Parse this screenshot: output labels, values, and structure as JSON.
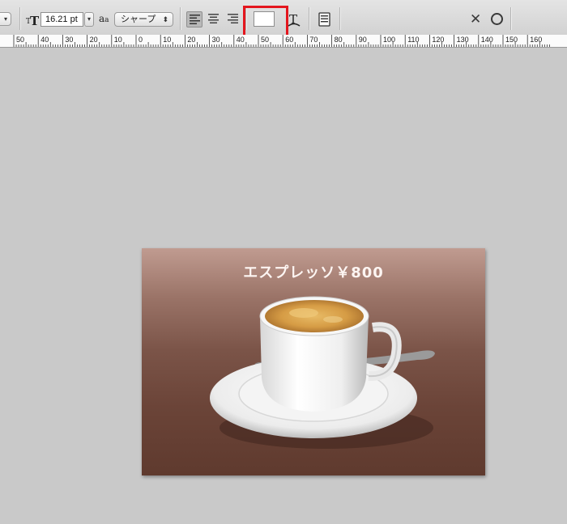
{
  "options_bar": {
    "font_size": "16.21 pt",
    "antialias_label": "a",
    "antialias_sub": "a",
    "antialias_method": "シャープ",
    "text_color": "#ffffff",
    "highlight_color": "#e4161e",
    "align_icons": [
      "align-left-icon",
      "align-center-icon",
      "align-right-icon"
    ],
    "icons": [
      "text-size-icon",
      "warp-text-icon",
      "character-panel-icon",
      "cancel-icon",
      "commit-icon"
    ]
  },
  "ruler": {
    "labels": [
      "50",
      "40",
      "30",
      "20",
      "10",
      "0",
      "10",
      "20",
      "30",
      "40",
      "50",
      "60",
      "70",
      "80",
      "90",
      "100",
      "110",
      "120",
      "130",
      "140",
      "150",
      "160"
    ]
  },
  "document": {
    "text_layer": "エスプレッソ￥800",
    "background_top": "#c09b90",
    "background_bottom": "#5f3a2e"
  }
}
